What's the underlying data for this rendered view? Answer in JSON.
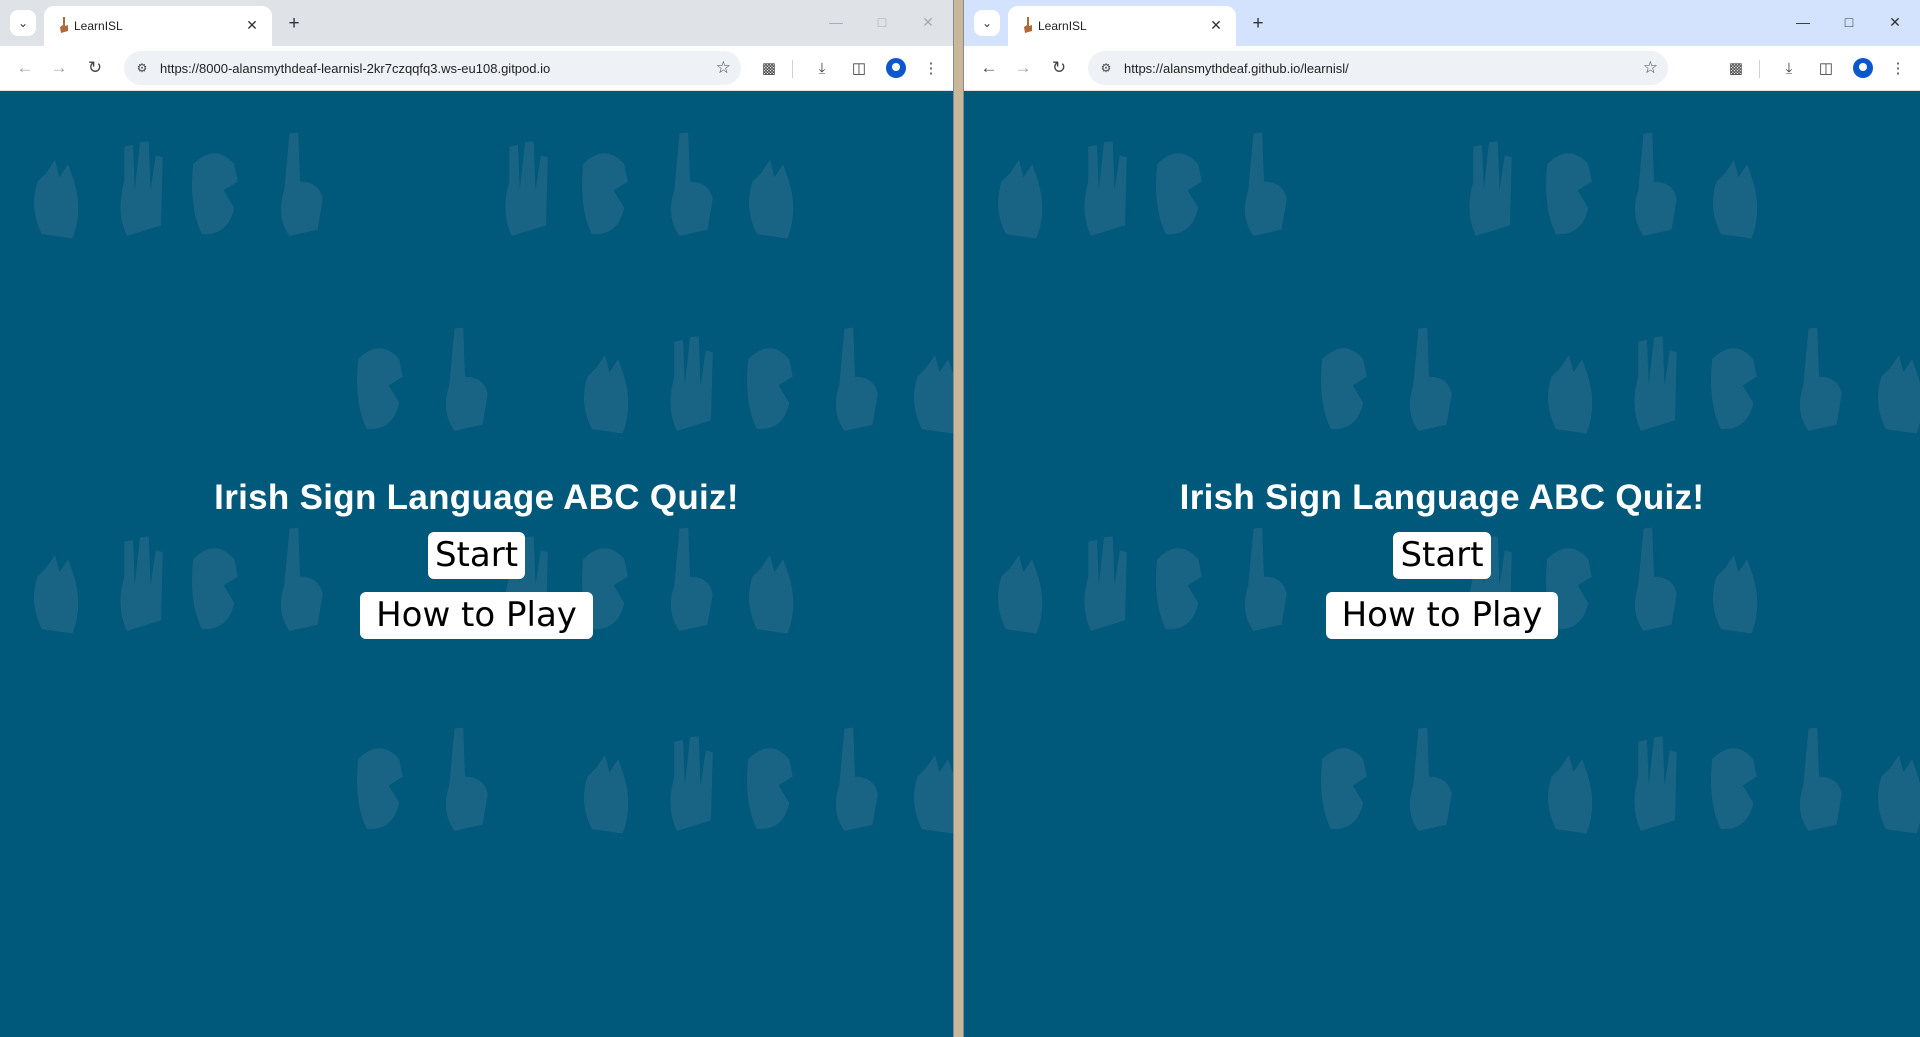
{
  "windows": [
    {
      "id": "left",
      "tab_title": "LearnISL",
      "url": "https://8000-alansmythdeaf-learnisl-2kr7czqqfq3.ws-eu108.gitpod.io",
      "page": {
        "title": "Irish Sign Language ABC Quiz!",
        "start_label": "Start",
        "howto_label": "How to Play"
      }
    },
    {
      "id": "right",
      "tab_title": "LearnISL",
      "url": "https://alansmythdeaf.github.io/learnisl/",
      "page": {
        "title": "Irish Sign Language ABC Quiz!",
        "start_label": "Start",
        "howto_label": "How to Play"
      }
    }
  ],
  "icons": {
    "tab_search": "chevron-down-icon",
    "close_tab": "close-icon",
    "new_tab": "plus-icon",
    "back": "arrow-left-icon",
    "forward": "arrow-right-icon",
    "reload": "reload-icon",
    "site_info": "tune-icon",
    "bookmark": "star-icon",
    "extensions": "puzzle-icon",
    "downloads": "download-icon",
    "side_panel": "side-panel-icon",
    "profile": "profile-icon",
    "menu": "kebab-menu-icon"
  },
  "colors": {
    "page_background": "#00587a",
    "hand_pattern": "#2e6f8e",
    "profile_accent": "#0b57d0"
  }
}
